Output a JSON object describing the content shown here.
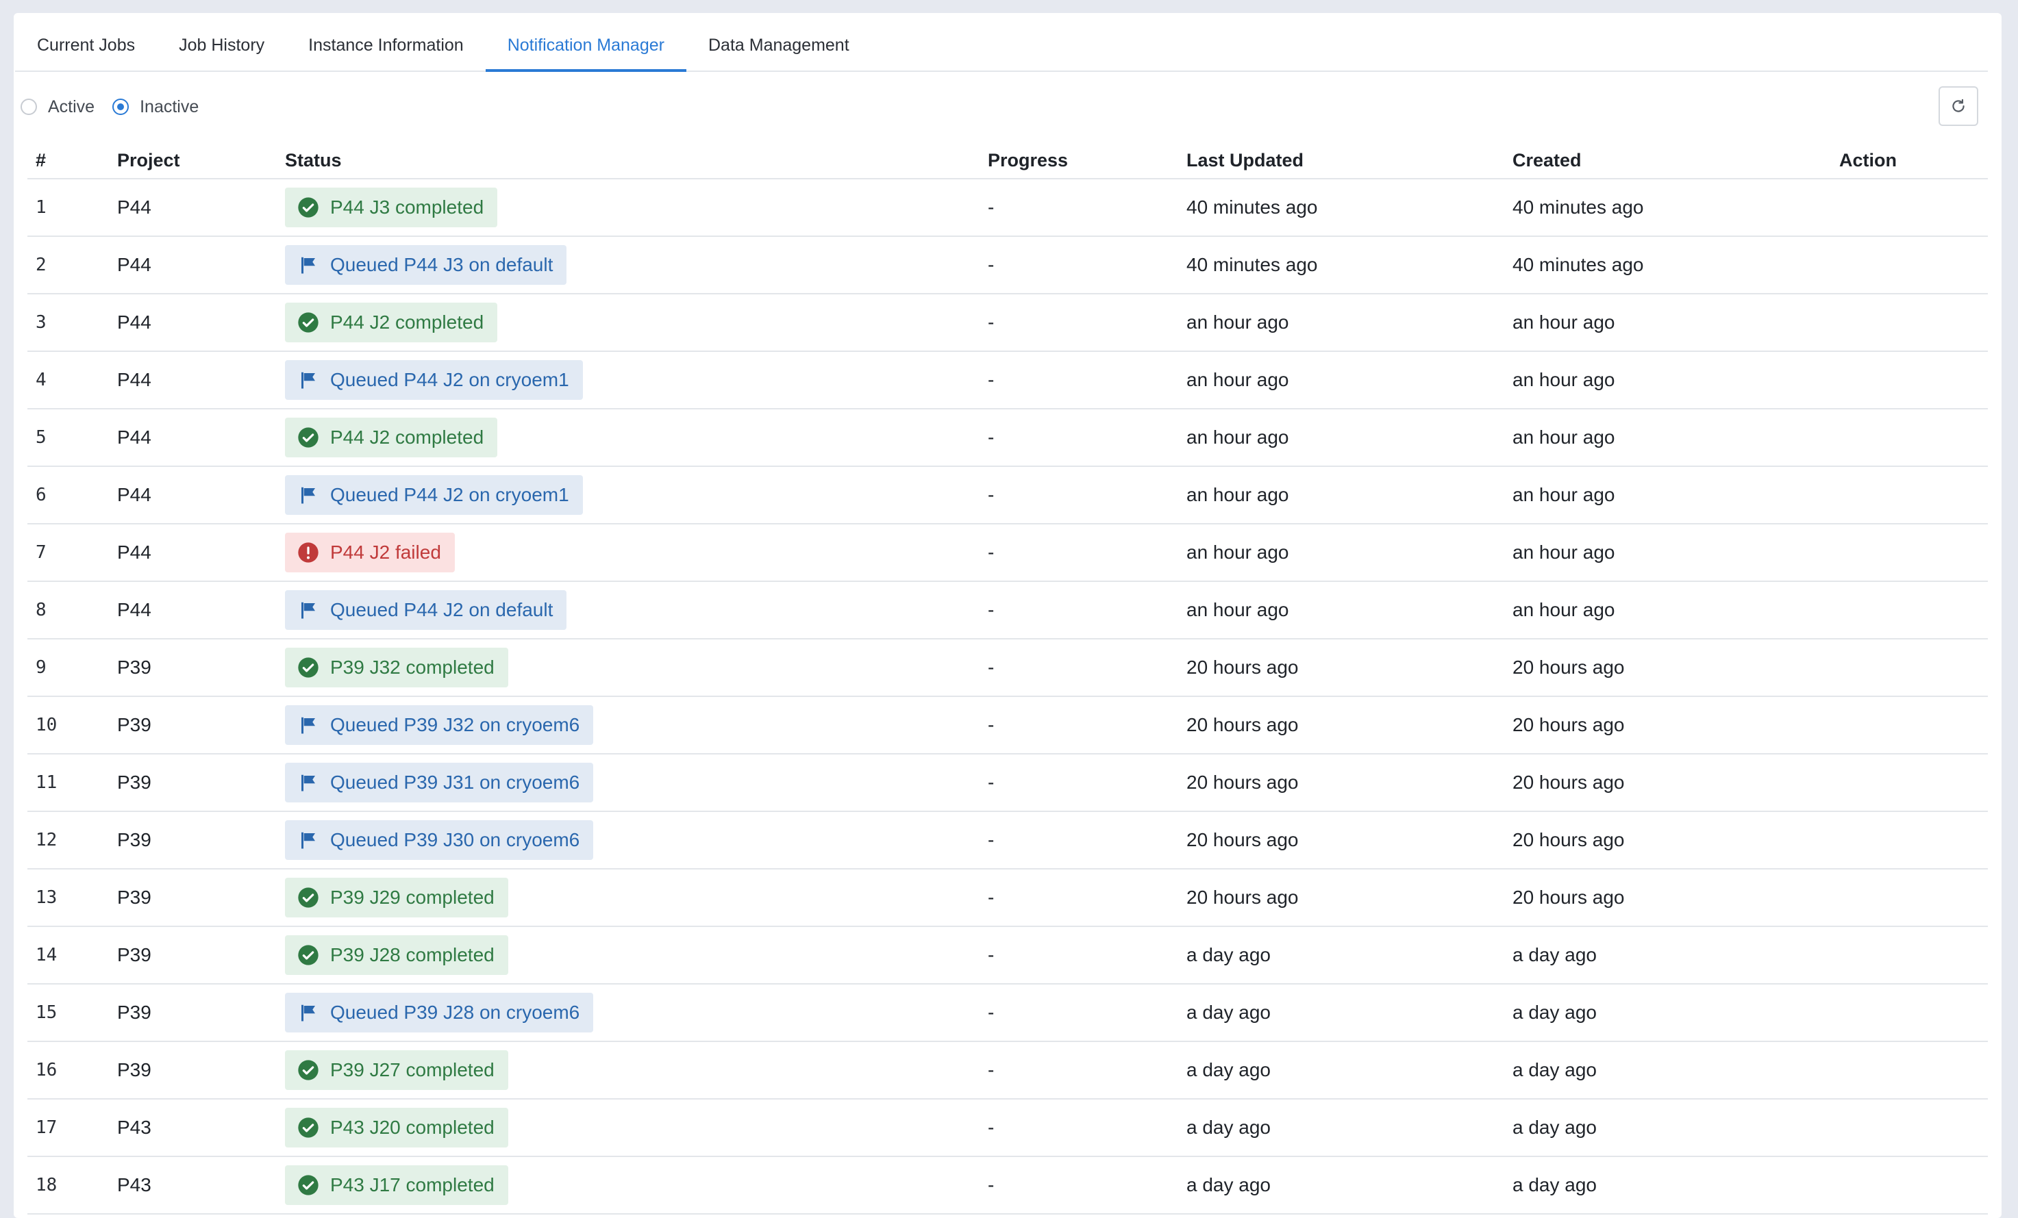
{
  "tabs": [
    {
      "label": "Current Jobs",
      "active": false
    },
    {
      "label": "Job History",
      "active": false
    },
    {
      "label": "Instance Information",
      "active": false
    },
    {
      "label": "Notification Manager",
      "active": true
    },
    {
      "label": "Data Management",
      "active": false
    }
  ],
  "filter": {
    "active_label": "Active",
    "inactive_label": "Inactive",
    "selected": "Inactive"
  },
  "table": {
    "columns": [
      "#",
      "Project",
      "Status",
      "Progress",
      "Last Updated",
      "Created",
      "Action"
    ],
    "rows": [
      {
        "num": "1",
        "project": "P44",
        "status": "P44 J3 completed",
        "type": "success",
        "progress": "-",
        "updated": "40 minutes ago",
        "created": "40 minutes ago"
      },
      {
        "num": "2",
        "project": "P44",
        "status": "Queued P44 J3 on default",
        "type": "queued",
        "progress": "-",
        "updated": "40 minutes ago",
        "created": "40 minutes ago"
      },
      {
        "num": "3",
        "project": "P44",
        "status": "P44 J2 completed",
        "type": "success",
        "progress": "-",
        "updated": "an hour ago",
        "created": "an hour ago"
      },
      {
        "num": "4",
        "project": "P44",
        "status": "Queued P44 J2 on cryoem1",
        "type": "queued",
        "progress": "-",
        "updated": "an hour ago",
        "created": "an hour ago"
      },
      {
        "num": "5",
        "project": "P44",
        "status": "P44 J2 completed",
        "type": "success",
        "progress": "-",
        "updated": "an hour ago",
        "created": "an hour ago"
      },
      {
        "num": "6",
        "project": "P44",
        "status": "Queued P44 J2 on cryoem1",
        "type": "queued",
        "progress": "-",
        "updated": "an hour ago",
        "created": "an hour ago"
      },
      {
        "num": "7",
        "project": "P44",
        "status": "P44 J2 failed",
        "type": "failed",
        "progress": "-",
        "updated": "an hour ago",
        "created": "an hour ago"
      },
      {
        "num": "8",
        "project": "P44",
        "status": "Queued P44 J2 on default",
        "type": "queued",
        "progress": "-",
        "updated": "an hour ago",
        "created": "an hour ago"
      },
      {
        "num": "9",
        "project": "P39",
        "status": "P39 J32 completed",
        "type": "success",
        "progress": "-",
        "updated": "20 hours ago",
        "created": "20 hours ago"
      },
      {
        "num": "10",
        "project": "P39",
        "status": "Queued P39 J32 on cryoem6",
        "type": "queued",
        "progress": "-",
        "updated": "20 hours ago",
        "created": "20 hours ago"
      },
      {
        "num": "11",
        "project": "P39",
        "status": "Queued P39 J31 on cryoem6",
        "type": "queued",
        "progress": "-",
        "updated": "20 hours ago",
        "created": "20 hours ago"
      },
      {
        "num": "12",
        "project": "P39",
        "status": "Queued P39 J30 on cryoem6",
        "type": "queued",
        "progress": "-",
        "updated": "20 hours ago",
        "created": "20 hours ago"
      },
      {
        "num": "13",
        "project": "P39",
        "status": "P39 J29 completed",
        "type": "success",
        "progress": "-",
        "updated": "20 hours ago",
        "created": "20 hours ago"
      },
      {
        "num": "14",
        "project": "P39",
        "status": "P39 J28 completed",
        "type": "success",
        "progress": "-",
        "updated": "a day ago",
        "created": "a day ago"
      },
      {
        "num": "15",
        "project": "P39",
        "status": "Queued P39 J28 on cryoem6",
        "type": "queued",
        "progress": "-",
        "updated": "a day ago",
        "created": "a day ago"
      },
      {
        "num": "16",
        "project": "P39",
        "status": "P39 J27 completed",
        "type": "success",
        "progress": "-",
        "updated": "a day ago",
        "created": "a day ago"
      },
      {
        "num": "17",
        "project": "P43",
        "status": "P43 J20 completed",
        "type": "success",
        "progress": "-",
        "updated": "a day ago",
        "created": "a day ago"
      },
      {
        "num": "18",
        "project": "P43",
        "status": "P43 J17 completed",
        "type": "success",
        "progress": "-",
        "updated": "a day ago",
        "created": "a day ago"
      }
    ]
  },
  "icons": {
    "success": "check-circle-icon",
    "queued": "flag-icon",
    "failed": "exclamation-circle-icon",
    "refresh": "refresh-icon"
  },
  "colors": {
    "accent": "#2a7ad5",
    "success_bg": "#e3f1e7",
    "success_fg": "#2f7a43",
    "queued_bg": "#e2eaf4",
    "queued_fg": "#2a67ad",
    "failed_bg": "#fbe1e1",
    "failed_fg": "#c03a3a"
  }
}
